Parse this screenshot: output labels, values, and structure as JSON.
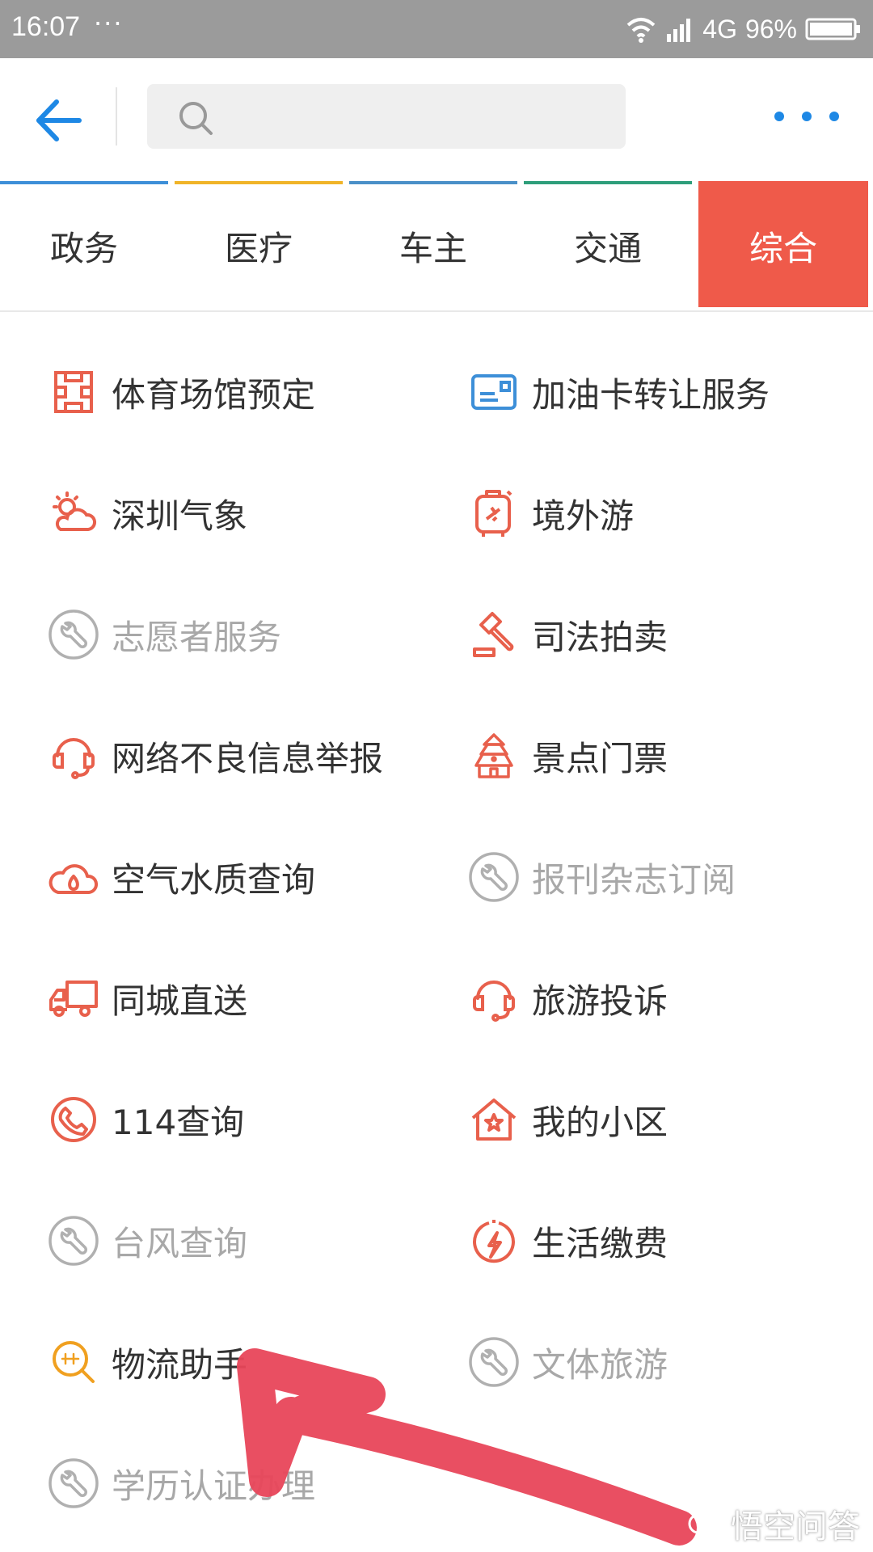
{
  "status_bar": {
    "time": "16:07",
    "dots": "···",
    "network": "4G",
    "battery": "96%"
  },
  "header": {
    "search_placeholder": ""
  },
  "tabs": [
    {
      "label": "政务",
      "color": "#3d8fd8"
    },
    {
      "label": "医疗",
      "color": "#f0b429"
    },
    {
      "label": "车主",
      "color": "#4a90c8"
    },
    {
      "label": "交通",
      "color": "#2e9e7a"
    },
    {
      "label": "综合",
      "color": "#ef5a4a",
      "active": true
    }
  ],
  "services": [
    {
      "label": "体育场馆预定",
      "icon": "stadium-icon",
      "enabled": true
    },
    {
      "label": "加油卡转让服务",
      "icon": "fuel-card-icon",
      "enabled": true
    },
    {
      "label": "深圳气象",
      "icon": "weather-icon",
      "enabled": true
    },
    {
      "label": "境外游",
      "icon": "luggage-icon",
      "enabled": true
    },
    {
      "label": "志愿者服务",
      "icon": "wrench-icon",
      "enabled": false
    },
    {
      "label": "司法拍卖",
      "icon": "gavel-icon",
      "enabled": true
    },
    {
      "label": "网络不良信息举报",
      "icon": "headset-icon",
      "enabled": true
    },
    {
      "label": "景点门票",
      "icon": "pagoda-icon",
      "enabled": true
    },
    {
      "label": "空气水质查询",
      "icon": "cloud-drop-icon",
      "enabled": true
    },
    {
      "label": "报刊杂志订阅",
      "icon": "wrench-icon",
      "enabled": false
    },
    {
      "label": "同城直送",
      "icon": "truck-icon",
      "enabled": true
    },
    {
      "label": "旅游投诉",
      "icon": "headset-icon",
      "enabled": true
    },
    {
      "label": "114查询",
      "icon": "phone-icon",
      "enabled": true
    },
    {
      "label": "我的小区",
      "icon": "house-star-icon",
      "enabled": true
    },
    {
      "label": "台风查询",
      "icon": "wrench-icon",
      "enabled": false
    },
    {
      "label": "生活缴费",
      "icon": "bolt-icon",
      "enabled": true
    },
    {
      "label": "物流助手",
      "icon": "logistics-search-icon",
      "enabled": true
    },
    {
      "label": "文体旅游",
      "icon": "wrench-icon",
      "enabled": false
    },
    {
      "label": "学历认证办理",
      "icon": "wrench-icon",
      "enabled": false
    }
  ],
  "watermark": {
    "text": "悟空问答"
  },
  "colors": {
    "accent_blue": "#1e88e5",
    "icon_red": "#e8604c",
    "icon_blue": "#3d8fd8",
    "icon_orange": "#f0a020",
    "disabled_gray": "#b0b0b0",
    "active_tab": "#ef5a4a",
    "annotation_arrow": "#e8465a"
  }
}
